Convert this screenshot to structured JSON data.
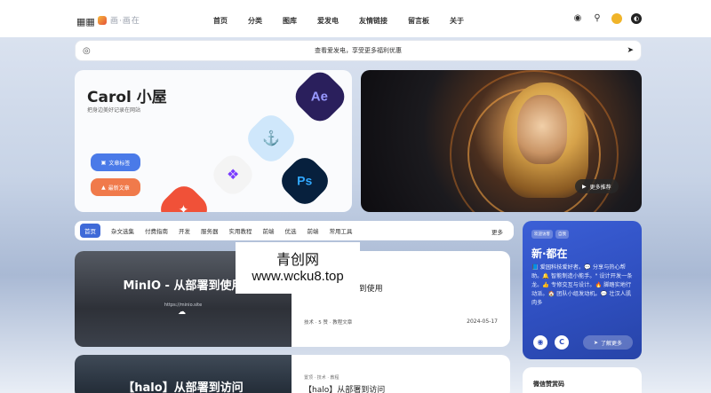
{
  "nav": {
    "menu_icon": "grid-icon",
    "logo_text": "画·画在",
    "items": [
      "首页",
      "分类",
      "图库",
      "爱发电",
      "友情链接",
      "留言板",
      "关于"
    ],
    "right_icons": [
      "github-icon",
      "search-icon",
      "avatar",
      "theme-toggle-icon"
    ]
  },
  "notice": {
    "text": "查看爱发电，享受更多福利优惠"
  },
  "hero": {
    "title": "Carol 小屋",
    "subtitle": "把身边美好记录在网站",
    "buttons": [
      {
        "label": "文章标签",
        "icon": "tag-icon"
      },
      {
        "label": "最新文章",
        "icon": "fire-icon"
      }
    ],
    "app_icons": [
      {
        "label": "Ae",
        "color": "#9999ff",
        "bg": "#2a1f5c"
      },
      {
        "label": "Ps",
        "color": "#31a8ff",
        "bg": "#07203d"
      },
      {
        "label": "",
        "name": "docker-icon",
        "color": "#2496ed"
      },
      {
        "label": "",
        "name": "final-cut-icon",
        "color": "#1e1e1e"
      },
      {
        "label": "",
        "name": "swift-icon",
        "color": "#f05138"
      }
    ]
  },
  "featured": {
    "more_label": "更多推荐"
  },
  "tabs": {
    "items": [
      "首页",
      "杂文选集",
      "付费指南",
      "开发",
      "服务器",
      "实用教程",
      "前端",
      "优选",
      "前端",
      "常用工具"
    ],
    "active_index": 0,
    "more_label": "更多"
  },
  "posts": [
    {
      "cover_title": "MinIO - 从部署到使用",
      "cover_sub": "https://minio.site",
      "title": "MinIO - 从部署到使用",
      "meta": "技术  ·  5 赞  ·  教程文章",
      "date": "2024-05-17"
    },
    {
      "cover_title": "【halo】从部署到访问",
      "title": "【halo】从部署到访问",
      "meta": "置顶  ·  技术  ·  教程"
    }
  ],
  "sidebar": {
    "badges": [
      "欢迎访客",
      "自我"
    ],
    "title": "新·都在",
    "description": "📘 爱园科技爱好者。💬 分享与热心帮助。🔔 智能制造小能手。\" 设计开发一条龙。👍 专修交互与设计。🔥 脚踏实地行动派。🏠 团队小组发动机。💬 壮汉人肌肉多",
    "icons": [
      "github-icon",
      "c-icon"
    ],
    "button_label": "了解更多"
  },
  "sidebar2": {
    "title": "微信赞赏码"
  },
  "watermark": {
    "cn": "青创网",
    "url": "www.wcku8.top"
  }
}
